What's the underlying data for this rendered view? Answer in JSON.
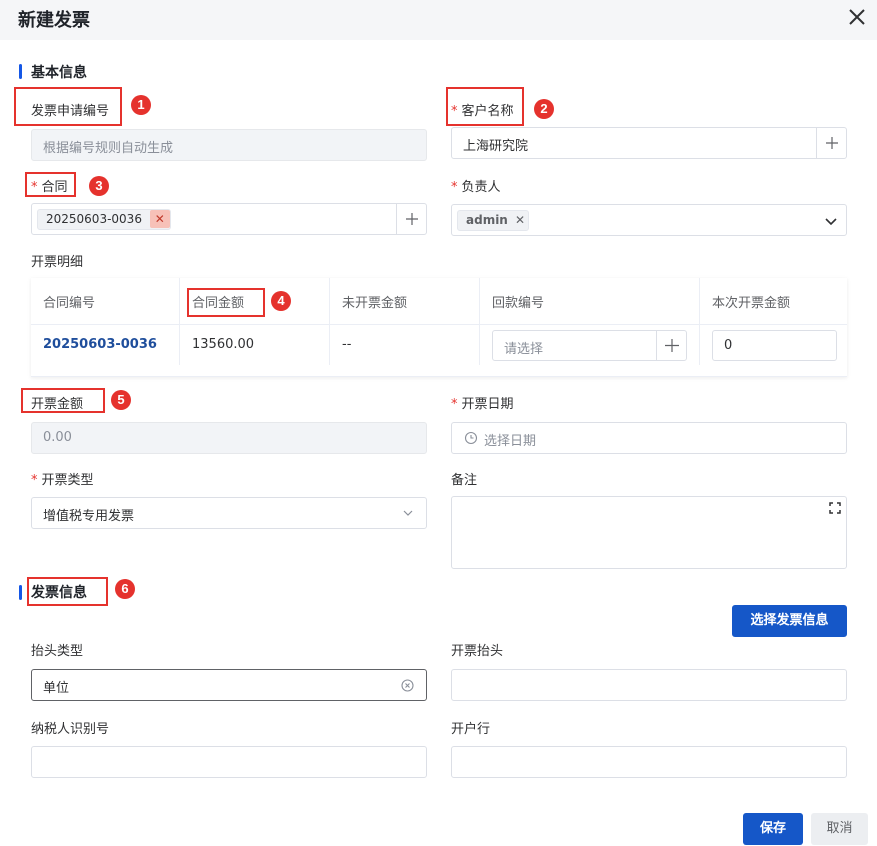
{
  "dialog": {
    "title": "新建发票"
  },
  "sections": {
    "basic": "基本信息",
    "invoice": "发票信息"
  },
  "fields": {
    "apply_no": {
      "label": "发票申请编号",
      "placeholder": "根据编号规则自动生成"
    },
    "customer": {
      "required": "*",
      "label": "客户名称",
      "value": "上海研究院"
    },
    "contract": {
      "required": "*",
      "label": "合同",
      "tag": "20250603-0036"
    },
    "owner": {
      "required": "*",
      "label": "负责人",
      "tag": "admin"
    },
    "detail": {
      "label": "开票明细"
    },
    "amount": {
      "label": "开票金额",
      "value": "0.00"
    },
    "date": {
      "required": "*",
      "label": "开票日期",
      "placeholder": "选择日期"
    },
    "type": {
      "required": "*",
      "label": "开票类型",
      "value": "增值税专用发票"
    },
    "remark": {
      "label": "备注"
    },
    "header_type": {
      "label": "抬头类型",
      "value": "单位"
    },
    "header": {
      "label": "开票抬头"
    },
    "tax_id": {
      "label": "纳税人识别号"
    },
    "bank": {
      "label": "开户行"
    }
  },
  "table": {
    "headers": [
      "合同编号",
      "合同金额",
      "未开票金额",
      "回款编号",
      "本次开票金额"
    ],
    "row": {
      "contract_no": "20250603-0036",
      "contract_amount": "13560.00",
      "uninvoiced": "--",
      "payment_placeholder": "请选择",
      "current_amount": "0"
    }
  },
  "buttons": {
    "select_invoice": "选择发票信息",
    "save": "保存",
    "cancel": "取消"
  },
  "annotations": [
    "1",
    "2",
    "3",
    "4",
    "5",
    "6"
  ],
  "colors": {
    "primary": "#1557c8",
    "required": "#e5322d",
    "annotation": "#e5322d"
  }
}
